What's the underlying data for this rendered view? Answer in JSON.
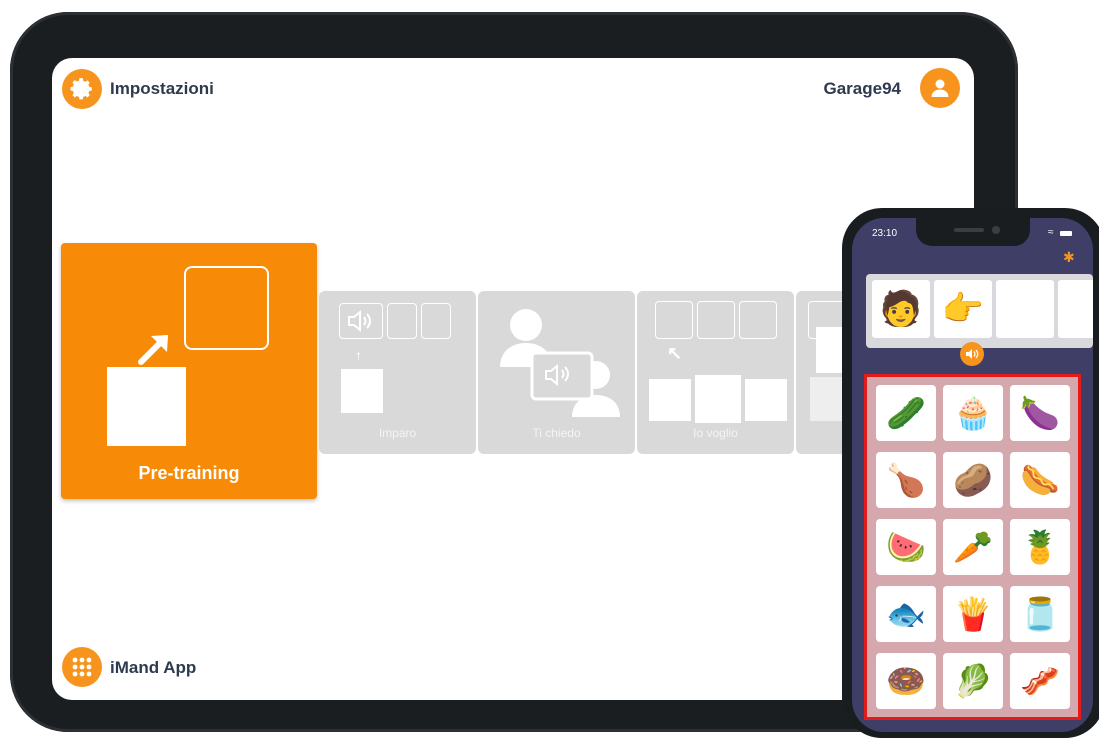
{
  "tablet": {
    "header": {
      "settings_label": "Impostazioni",
      "user_label": "Garage94"
    },
    "footer": {
      "app_label": "iMand App"
    },
    "modes": [
      {
        "label": "Pre-training",
        "active": true
      },
      {
        "label": "Imparo",
        "active": false
      },
      {
        "label": "Ti chiedo",
        "active": false
      },
      {
        "label": "Io voglio",
        "active": false
      }
    ],
    "accent_color": "#f7941d",
    "inactive_card_color": "#d9d9d9"
  },
  "phone": {
    "status_time": "23:10",
    "sentence_tiles": [
      {
        "icon": "person-icon",
        "glyph": "🧑"
      },
      {
        "icon": "hand-pointing-icon",
        "glyph": "👉"
      },
      {
        "icon": "empty-slot",
        "glyph": ""
      },
      {
        "icon": "empty-slot",
        "glyph": ""
      }
    ],
    "grid": [
      {
        "icon": "zucchini-icon",
        "glyph": "🥒"
      },
      {
        "icon": "pastries-box-icon",
        "glyph": "🧁"
      },
      {
        "icon": "eggplant-icon",
        "glyph": "🍆"
      },
      {
        "icon": "chicken-leg-icon",
        "glyph": "🍗"
      },
      {
        "icon": "potatoes-icon",
        "glyph": "🥔"
      },
      {
        "icon": "sausage-icon",
        "glyph": "🌭"
      },
      {
        "icon": "watermelon-icon",
        "glyph": "🍉"
      },
      {
        "icon": "carrot-icon",
        "glyph": "🥕"
      },
      {
        "icon": "pineapple-icon",
        "glyph": "🍍"
      },
      {
        "icon": "fish-plate-icon",
        "glyph": "🐟"
      },
      {
        "icon": "fries-icon",
        "glyph": "🍟"
      },
      {
        "icon": "jar-icon",
        "glyph": "🫙"
      },
      {
        "icon": "donut-icon",
        "glyph": "🍩"
      },
      {
        "icon": "asparagus-icon",
        "glyph": "🥬"
      },
      {
        "icon": "salami-icon",
        "glyph": "🥓"
      }
    ],
    "grid_highlight_color": "#e31b1b",
    "grid_background_color": "#d4a8ad"
  }
}
